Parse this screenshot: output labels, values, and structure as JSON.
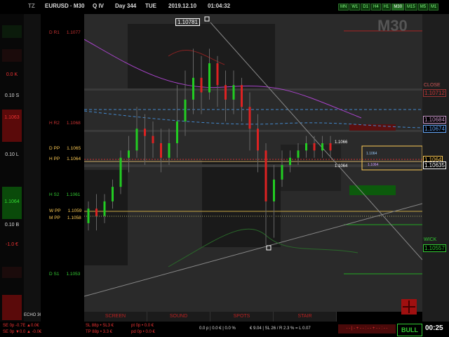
{
  "header": {
    "tz": "TZ",
    "symbol": "EURUSD · M30",
    "quarter": "Q IV",
    "day": "Day 344",
    "weekday": "TUE",
    "date": "2019.12.10",
    "time": "01:04:32",
    "timeframes": [
      "MN",
      "W1",
      "D1",
      "H4",
      "H1",
      "M30",
      "M15",
      "M5",
      "M1"
    ],
    "active_timeframe": "M30"
  },
  "watermark": "M30",
  "left_panel": {
    "cells": [
      {
        "text": "0.0 K",
        "color": "#e33"
      },
      {
        "text": "0.10 S",
        "color": "#ddd"
      },
      {
        "text": "1.1063",
        "color": "#e33"
      },
      {
        "text": "0.10 L",
        "color": "#ddd"
      },
      {
        "text": "1.1064",
        "color": "#3d3"
      },
      {
        "text": "0.10 B",
        "color": "#ddd"
      },
      {
        "text": "-1.0 €",
        "color": "#e33"
      }
    ],
    "small_labels": [
      "0 bu 0.0"
    ],
    "echo": "ECHO 36"
  },
  "pivots": [
    {
      "name": "D R1",
      "price": "1.1077"
    },
    {
      "name": "H R2",
      "price": "1.1068"
    },
    {
      "name": "D PP",
      "price": "1.1065"
    },
    {
      "name": "H PP",
      "price": "1.1064"
    },
    {
      "name": "H S2",
      "price": "1.1061"
    },
    {
      "name": "W PP",
      "price": "1.1059"
    },
    {
      "name": "M PP",
      "price": "1.1058"
    },
    {
      "name": "D S1",
      "price": "1.1053"
    }
  ],
  "pivot_extra": "D 1.1064",
  "chart_labels": {
    "high_marker": "1.10781",
    "r1": "1.1066",
    "r2": "1.1064",
    "s_label": "1.1064",
    "s_label2": "1.1064"
  },
  "right_panel": {
    "close_label": "CLOSE",
    "prices": [
      {
        "text": "1.10684",
        "color": "#c9c"
      },
      {
        "text": "1.10674",
        "color": "#6af"
      },
      {
        "text": "1.1064",
        "color": "#fc5"
      },
      {
        "text": "1.10635",
        "color": "#fff"
      }
    ],
    "close_price": "1.10712",
    "wick_label": "WICK",
    "wick_price": "1.10557"
  },
  "tabs": [
    "SCREEN",
    "SOUND",
    "SPOTS",
    "STAIR"
  ],
  "bottom": {
    "left1": "SE 0p  -0.7E  ▲0.0€",
    "left2": "SE 0p  ▼0.0 ▲  -0.0€",
    "mid1": "SL 88p • SL3 €",
    "mid2": "TP 88p • 3.3 €",
    "mid3": "pt 0p • 0.0 €",
    "mid4": "pd 0p • 0.0 €",
    "stats": "0.0 p | 0.0 € | 0.0 %",
    "risk": "€ 9.04 | SL 26 / R 2.3 % = L 0.07",
    "pattern": "- - | - + - - : - - + - - : - -",
    "bias": "BULL",
    "timer": "00:25"
  },
  "chart_data": {
    "type": "candlestick",
    "symbol": "EURUSD",
    "timeframe": "M30",
    "ylim": [
      1.1048,
      1.1082
    ],
    "candles": [
      {
        "o": 1.1054,
        "c": 1.1056,
        "l": 1.1053,
        "h": 1.1057
      },
      {
        "o": 1.1056,
        "c": 1.1055,
        "l": 1.1053,
        "h": 1.1058
      },
      {
        "o": 1.1055,
        "c": 1.1057,
        "l": 1.1054,
        "h": 1.1058
      },
      {
        "o": 1.1057,
        "c": 1.1059,
        "l": 1.1056,
        "h": 1.106
      },
      {
        "o": 1.1059,
        "c": 1.1063,
        "l": 1.1058,
        "h": 1.1064
      },
      {
        "o": 1.1063,
        "c": 1.1064,
        "l": 1.1061,
        "h": 1.1066
      },
      {
        "o": 1.1064,
        "c": 1.1067,
        "l": 1.1063,
        "h": 1.107
      },
      {
        "o": 1.1067,
        "c": 1.1066,
        "l": 1.1062,
        "h": 1.1069
      },
      {
        "o": 1.1066,
        "c": 1.1065,
        "l": 1.1063,
        "h": 1.1068
      },
      {
        "o": 1.1065,
        "c": 1.1063,
        "l": 1.1061,
        "h": 1.1067
      },
      {
        "o": 1.1063,
        "c": 1.1065,
        "l": 1.1062,
        "h": 1.1067
      },
      {
        "o": 1.1065,
        "c": 1.1068,
        "l": 1.1063,
        "h": 1.1073
      },
      {
        "o": 1.1068,
        "c": 1.1071,
        "l": 1.1066,
        "h": 1.1075
      },
      {
        "o": 1.1071,
        "c": 1.1074,
        "l": 1.1069,
        "h": 1.1078
      },
      {
        "o": 1.1074,
        "c": 1.1072,
        "l": 1.1069,
        "h": 1.1077
      },
      {
        "o": 1.1072,
        "c": 1.1076,
        "l": 1.1071,
        "h": 1.1078
      },
      {
        "o": 1.1076,
        "c": 1.1073,
        "l": 1.107,
        "h": 1.1077
      },
      {
        "o": 1.1073,
        "c": 1.1071,
        "l": 1.1068,
        "h": 1.1075
      },
      {
        "o": 1.1071,
        "c": 1.1073,
        "l": 1.1069,
        "h": 1.1075
      },
      {
        "o": 1.1073,
        "c": 1.107,
        "l": 1.1068,
        "h": 1.1074
      },
      {
        "o": 1.107,
        "c": 1.1067,
        "l": 1.1064,
        "h": 1.1072
      },
      {
        "o": 1.1067,
        "c": 1.1064,
        "l": 1.1061,
        "h": 1.1069
      },
      {
        "o": 1.1064,
        "c": 1.1057,
        "l": 1.1051,
        "h": 1.1065
      },
      {
        "o": 1.1057,
        "c": 1.106,
        "l": 1.1052,
        "h": 1.1062
      },
      {
        "o": 1.106,
        "c": 1.1062,
        "l": 1.1059,
        "h": 1.1064
      },
      {
        "o": 1.1062,
        "c": 1.1063,
        "l": 1.1061,
        "h": 1.1064
      },
      {
        "o": 1.1063,
        "c": 1.1064,
        "l": 1.1062,
        "h": 1.1065
      },
      {
        "o": 1.1064,
        "c": 1.1065,
        "l": 1.1063,
        "h": 1.1066
      },
      {
        "o": 1.1065,
        "c": 1.1064,
        "l": 1.1063,
        "h": 1.1066
      },
      {
        "o": 1.1064,
        "c": 1.1065,
        "l": 1.1063,
        "h": 1.1066
      },
      {
        "o": 1.1065,
        "c": 1.1064,
        "l": 1.1063,
        "h": 1.1066
      }
    ]
  }
}
